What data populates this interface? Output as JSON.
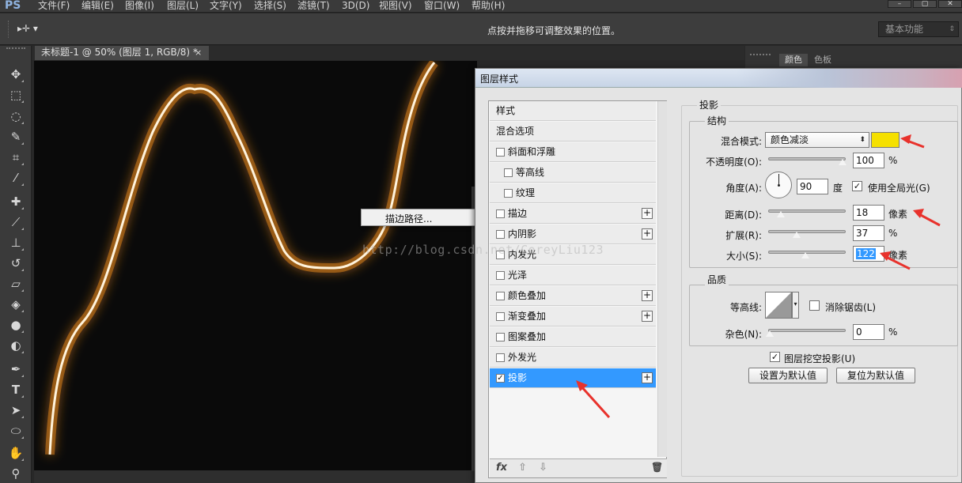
{
  "app": {
    "logo": "PS",
    "menu": [
      "文件(F)",
      "编辑(E)",
      "图像(I)",
      "图层(L)",
      "文字(Y)",
      "选择(S)",
      "滤镜(T)",
      "3D(D)",
      "视图(V)",
      "窗口(W)",
      "帮助(H)"
    ],
    "window_buttons": [
      "–",
      "▢",
      "✕"
    ]
  },
  "options_bar": {
    "tool_glyph": "▸✛ ▾",
    "hint": "点按并拖移可调整效果的位置。",
    "workspace": "基本功能"
  },
  "document": {
    "tab_title": "未标题-1 @ 50% (图层 1, RGB/8) *",
    "close": "×"
  },
  "context_menu": {
    "item": "描边路径..."
  },
  "right_panel": {
    "tab_color": "颜色",
    "tab_swatches": "色板"
  },
  "dialog": {
    "title": "图层样式",
    "styles": [
      {
        "label": "样式",
        "checkbox": false,
        "plus": false,
        "selected": false,
        "indent": false
      },
      {
        "label": "混合选项",
        "checkbox": false,
        "plus": false,
        "selected": false,
        "indent": false
      },
      {
        "label": "斜面和浮雕",
        "checkbox": true,
        "checked": false,
        "plus": false,
        "selected": false,
        "indent": false
      },
      {
        "label": "等高线",
        "checkbox": true,
        "checked": false,
        "plus": false,
        "selected": false,
        "indent": true
      },
      {
        "label": "纹理",
        "checkbox": true,
        "checked": false,
        "plus": false,
        "selected": false,
        "indent": true
      },
      {
        "label": "描边",
        "checkbox": true,
        "checked": false,
        "plus": true,
        "selected": false,
        "indent": false
      },
      {
        "label": "内阴影",
        "checkbox": true,
        "checked": false,
        "plus": true,
        "selected": false,
        "indent": false
      },
      {
        "label": "内发光",
        "checkbox": true,
        "checked": false,
        "plus": false,
        "selected": false,
        "indent": false
      },
      {
        "label": "光泽",
        "checkbox": true,
        "checked": false,
        "plus": false,
        "selected": false,
        "indent": false
      },
      {
        "label": "颜色叠加",
        "checkbox": true,
        "checked": false,
        "plus": true,
        "selected": false,
        "indent": false
      },
      {
        "label": "渐变叠加",
        "checkbox": true,
        "checked": false,
        "plus": true,
        "selected": false,
        "indent": false
      },
      {
        "label": "图案叠加",
        "checkbox": true,
        "checked": false,
        "plus": false,
        "selected": false,
        "indent": false
      },
      {
        "label": "外发光",
        "checkbox": true,
        "checked": false,
        "plus": false,
        "selected": false,
        "indent": false
      },
      {
        "label": "投影",
        "checkbox": true,
        "checked": true,
        "plus": true,
        "selected": true,
        "indent": false
      }
    ],
    "footer": {
      "fx": "fx",
      "up": "⇧",
      "down": "⇩",
      "trash": "🗑"
    },
    "drop_shadow": {
      "section_title": "投影",
      "structure": {
        "legend": "结构",
        "blend_mode_label": "混合模式:",
        "blend_mode_value": "颜色减淡",
        "color": "#f5e000",
        "opacity_label": "不透明度(O):",
        "opacity_value": "100",
        "opacity_level": 100,
        "opacity_unit": "%",
        "angle_label": "角度(A):",
        "angle_value": "90",
        "angle_unit": "度",
        "global_light_label": "使用全局光(G)",
        "global_light_checked": "✓",
        "distance_label": "距离(D):",
        "distance_value": "18",
        "distance_level": 18,
        "distance_unit": "像素",
        "spread_label": "扩展(R):",
        "spread_value": "37",
        "spread_level": 37,
        "spread_unit": "%",
        "size_label": "大小(S):",
        "size_value": "122",
        "size_level": 122,
        "size_unit": "像素"
      },
      "quality": {
        "legend": "品质",
        "contour_label": "等高线:",
        "antialias_label": "消除锯齿(L)",
        "noise_label": "杂色(N):",
        "noise_value": "0",
        "noise_level": 0,
        "noise_unit": "%"
      },
      "knockout_label": "图层挖空投影(U)",
      "knockout_checked": "✓",
      "make_default": "设置为默认值",
      "reset_default": "复位为默认值"
    }
  },
  "watermark": "http://blog.csdn.net/CoreyLiu123",
  "colors": {
    "accent_blue": "#3399ff",
    "annotation_red": "#e8322c",
    "glow_orange": "#d9801e"
  }
}
